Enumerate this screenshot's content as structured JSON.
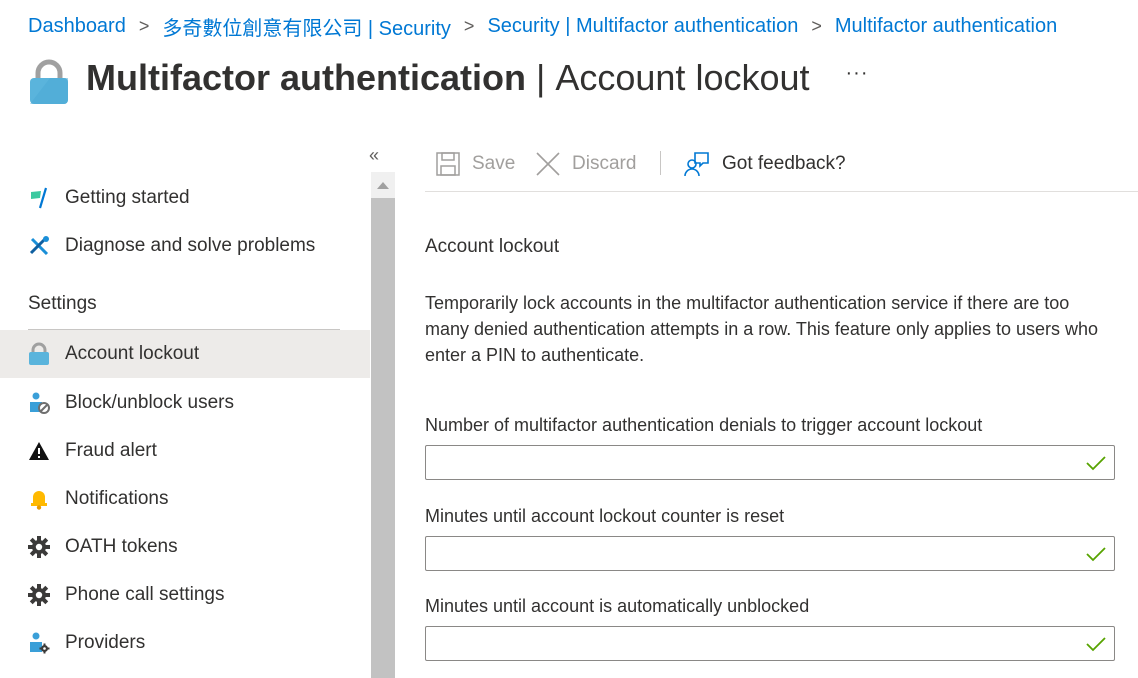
{
  "breadcrumb": {
    "items": [
      "Dashboard",
      "多奇數位創意有限公司 | Security",
      "Security | Multifactor authentication",
      "Multifactor authentication"
    ],
    "separator": ">"
  },
  "header": {
    "icon": "lock-icon",
    "title_main": "Multifactor authentication",
    "title_separator": "|",
    "title_sub": "Account lockout",
    "more_label": "···"
  },
  "sidebar": {
    "collapse_label": "«",
    "items_top": [
      {
        "label": "Getting started",
        "icon": "flag-icon"
      },
      {
        "label": "Diagnose and solve problems",
        "icon": "wrench-icon"
      }
    ],
    "section_header": "Settings",
    "items_settings": [
      {
        "label": "Account lockout",
        "icon": "lock-icon",
        "selected": true
      },
      {
        "label": "Block/unblock users",
        "icon": "user-block-icon"
      },
      {
        "label": "Fraud alert",
        "icon": "warning-icon"
      },
      {
        "label": "Notifications",
        "icon": "bell-icon"
      },
      {
        "label": "OATH tokens",
        "icon": "gear-icon"
      },
      {
        "label": "Phone call settings",
        "icon": "gear-icon"
      },
      {
        "label": "Providers",
        "icon": "user-gear-icon"
      }
    ]
  },
  "toolbar": {
    "save_label": "Save",
    "discard_label": "Discard",
    "feedback_label": "Got feedback?"
  },
  "main": {
    "section_title": "Account lockout",
    "description": "Temporarily lock accounts in the multifactor authentication service if there are too many denied authentication attempts in a row. This feature only applies to users who enter a PIN to authenticate.",
    "fields": [
      {
        "label": "Number of multifactor authentication denials to trigger account lockout",
        "value": "",
        "valid": true
      },
      {
        "label": "Minutes until account lockout counter is reset",
        "value": "",
        "valid": true
      },
      {
        "label": "Minutes until account is automatically unblocked",
        "value": "",
        "valid": true
      }
    ]
  },
  "colors": {
    "accent": "#0078d4",
    "selected_bg": "#edebe9",
    "valid_check": "#57a300"
  }
}
